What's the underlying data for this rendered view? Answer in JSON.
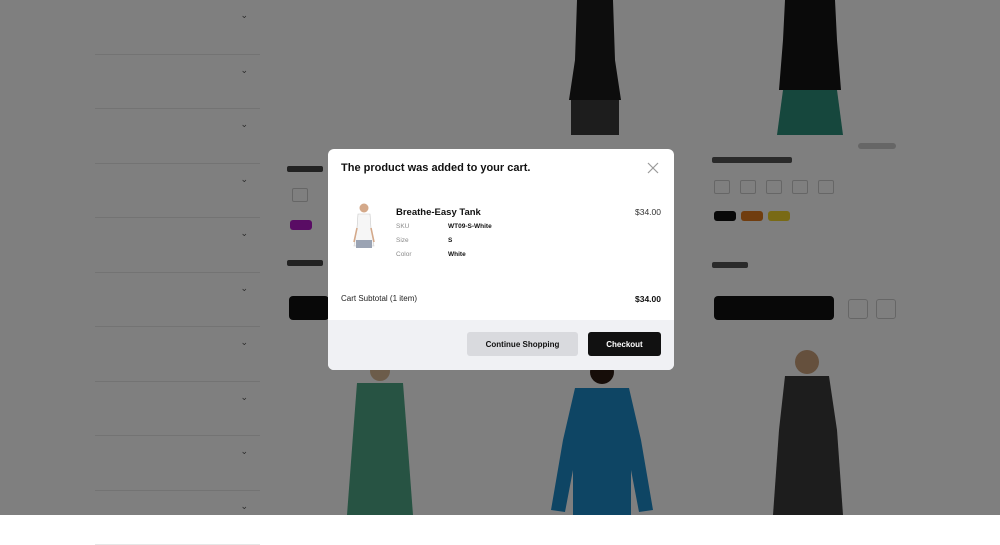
{
  "modal": {
    "title": "The product was added to your cart.",
    "close_icon": "close-icon",
    "item": {
      "name": "Breathe-Easy Tank",
      "price": "$34.00",
      "attributes": [
        {
          "label": "SKU",
          "value": "WT09-S-White"
        },
        {
          "label": "Size",
          "value": "S"
        },
        {
          "label": "Color",
          "value": "White"
        }
      ]
    },
    "subtotal_label": "Cart Subtotal (1 item)",
    "subtotal_value": "$34.00",
    "continue_label": "Continue Shopping",
    "checkout_label": "Checkout"
  },
  "colors": {
    "overlay": "#000000",
    "checkout_button": "#111111",
    "continue_button": "#d9dade",
    "footer": "#f0f1f4"
  }
}
